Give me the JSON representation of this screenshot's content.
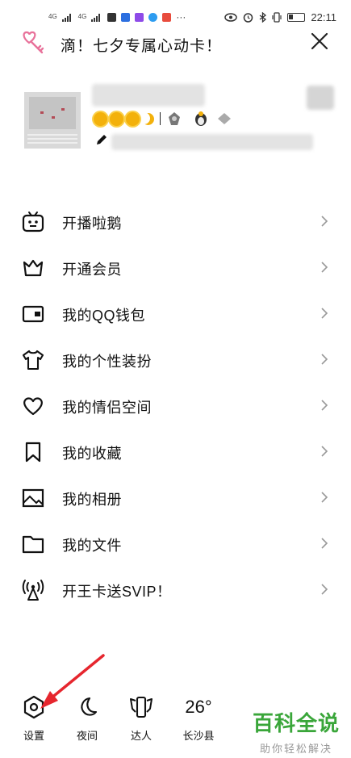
{
  "status_bar": {
    "signal_1": "4G",
    "signal_2": "4G",
    "time": "22:11",
    "more": "···"
  },
  "header": {
    "title": "滴！七夕专属心动卡！"
  },
  "menu": [
    {
      "label": "开播啦鹅",
      "icon": "tv-icon"
    },
    {
      "label": "开通会员",
      "icon": "crown-icon"
    },
    {
      "label": "我的QQ钱包",
      "icon": "wallet-icon"
    },
    {
      "label": "我的个性装扮",
      "icon": "tshirt-icon"
    },
    {
      "label": "我的情侣空间",
      "icon": "heart-icon"
    },
    {
      "label": "我的收藏",
      "icon": "bookmark-icon"
    },
    {
      "label": "我的相册",
      "icon": "photo-icon"
    },
    {
      "label": "我的文件",
      "icon": "folder-icon"
    },
    {
      "label": "开王卡送SVIP！",
      "icon": "signal-tower-icon"
    }
  ],
  "bottom": {
    "settings": "设置",
    "night": "夜间",
    "talent": "达人",
    "temperature": "26°",
    "city": "长沙县"
  },
  "watermark": {
    "main": "百科全说",
    "sub": "助你轻松解决"
  },
  "colors": {
    "accent_pink": "#e8719a",
    "annotation_red": "#e6262e",
    "watermark_green": "#3aa63a",
    "level_gold": "#f3b10b"
  }
}
